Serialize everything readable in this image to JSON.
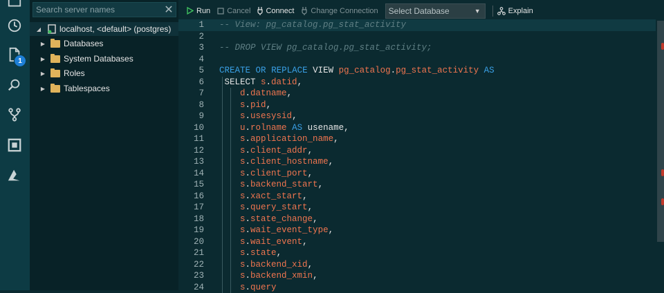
{
  "activity_bar": {
    "icons": [
      "servers-icon",
      "history-icon",
      "file-explorer-icon",
      "search-icon",
      "source-control-icon",
      "extensions-icon",
      "azure-icon"
    ],
    "badge": "1"
  },
  "sidebar": {
    "search_placeholder": "Search server names",
    "server": "localhost, <default> (postgres)",
    "folders": [
      "Databases",
      "System Databases",
      "Roles",
      "Tablespaces"
    ]
  },
  "toolbar": {
    "run": "Run",
    "cancel": "Cancel",
    "connect": "Connect",
    "change_connection": "Change Connection",
    "select_database": "Select Database",
    "explain": "Explain"
  },
  "editor": {
    "lines": [
      {
        "n": "1",
        "tokens": [
          [
            "cm",
            "-- View: pg_catalog.pg_stat_activity"
          ]
        ]
      },
      {
        "n": "2",
        "tokens": []
      },
      {
        "n": "3",
        "tokens": [
          [
            "cm",
            "-- DROP VIEW pg_catalog.pg_stat_activity;"
          ]
        ]
      },
      {
        "n": "4",
        "tokens": []
      },
      {
        "n": "5",
        "tokens": [
          [
            "kw",
            "CREATE"
          ],
          [
            "pl",
            " "
          ],
          [
            "kw",
            "OR"
          ],
          [
            "pl",
            " "
          ],
          [
            "kw",
            "REPLACE"
          ],
          [
            "pl",
            " VIEW "
          ],
          [
            "id",
            "pg_catalog"
          ],
          [
            "pl",
            "."
          ],
          [
            "id",
            "pg_stat_activity"
          ],
          [
            "pl",
            " "
          ],
          [
            "kw",
            "AS"
          ]
        ]
      },
      {
        "n": "6",
        "tokens": [
          [
            "pl",
            " SELECT "
          ],
          [
            "id",
            "s"
          ],
          [
            "pl",
            "."
          ],
          [
            "id",
            "datid"
          ],
          [
            "pl",
            ","
          ]
        ]
      },
      {
        "n": "7",
        "tokens": [
          [
            "pl",
            "    "
          ],
          [
            "id",
            "d"
          ],
          [
            "pl",
            "."
          ],
          [
            "id",
            "datname"
          ],
          [
            "pl",
            ","
          ]
        ]
      },
      {
        "n": "8",
        "tokens": [
          [
            "pl",
            "    "
          ],
          [
            "id",
            "s"
          ],
          [
            "pl",
            "."
          ],
          [
            "id",
            "pid"
          ],
          [
            "pl",
            ","
          ]
        ]
      },
      {
        "n": "9",
        "tokens": [
          [
            "pl",
            "    "
          ],
          [
            "id",
            "s"
          ],
          [
            "pl",
            "."
          ],
          [
            "id",
            "usesysid"
          ],
          [
            "pl",
            ","
          ]
        ]
      },
      {
        "n": "10",
        "tokens": [
          [
            "pl",
            "    "
          ],
          [
            "id",
            "u"
          ],
          [
            "pl",
            "."
          ],
          [
            "id",
            "rolname"
          ],
          [
            "pl",
            " "
          ],
          [
            "kw",
            "AS"
          ],
          [
            "pl",
            " usename,"
          ]
        ]
      },
      {
        "n": "11",
        "tokens": [
          [
            "pl",
            "    "
          ],
          [
            "id",
            "s"
          ],
          [
            "pl",
            "."
          ],
          [
            "id",
            "application_name"
          ],
          [
            "pl",
            ","
          ]
        ]
      },
      {
        "n": "12",
        "tokens": [
          [
            "pl",
            "    "
          ],
          [
            "id",
            "s"
          ],
          [
            "pl",
            "."
          ],
          [
            "id",
            "client_addr"
          ],
          [
            "pl",
            ","
          ]
        ]
      },
      {
        "n": "13",
        "tokens": [
          [
            "pl",
            "    "
          ],
          [
            "id",
            "s"
          ],
          [
            "pl",
            "."
          ],
          [
            "id",
            "client_hostname"
          ],
          [
            "pl",
            ","
          ]
        ]
      },
      {
        "n": "14",
        "tokens": [
          [
            "pl",
            "    "
          ],
          [
            "id",
            "s"
          ],
          [
            "pl",
            "."
          ],
          [
            "id",
            "client_port"
          ],
          [
            "pl",
            ","
          ]
        ]
      },
      {
        "n": "15",
        "tokens": [
          [
            "pl",
            "    "
          ],
          [
            "id",
            "s"
          ],
          [
            "pl",
            "."
          ],
          [
            "id",
            "backend_start"
          ],
          [
            "pl",
            ","
          ]
        ]
      },
      {
        "n": "16",
        "tokens": [
          [
            "pl",
            "    "
          ],
          [
            "id",
            "s"
          ],
          [
            "pl",
            "."
          ],
          [
            "id",
            "xact_start"
          ],
          [
            "pl",
            ","
          ]
        ]
      },
      {
        "n": "17",
        "tokens": [
          [
            "pl",
            "    "
          ],
          [
            "id",
            "s"
          ],
          [
            "pl",
            "."
          ],
          [
            "id",
            "query_start"
          ],
          [
            "pl",
            ","
          ]
        ]
      },
      {
        "n": "18",
        "tokens": [
          [
            "pl",
            "    "
          ],
          [
            "id",
            "s"
          ],
          [
            "pl",
            "."
          ],
          [
            "id",
            "state_change"
          ],
          [
            "pl",
            ","
          ]
        ]
      },
      {
        "n": "19",
        "tokens": [
          [
            "pl",
            "    "
          ],
          [
            "id",
            "s"
          ],
          [
            "pl",
            "."
          ],
          [
            "id",
            "wait_event_type"
          ],
          [
            "pl",
            ","
          ]
        ]
      },
      {
        "n": "20",
        "tokens": [
          [
            "pl",
            "    "
          ],
          [
            "id",
            "s"
          ],
          [
            "pl",
            "."
          ],
          [
            "id",
            "wait_event"
          ],
          [
            "pl",
            ","
          ]
        ]
      },
      {
        "n": "21",
        "tokens": [
          [
            "pl",
            "    "
          ],
          [
            "id",
            "s"
          ],
          [
            "pl",
            "."
          ],
          [
            "id",
            "state"
          ],
          [
            "pl",
            ","
          ]
        ]
      },
      {
        "n": "22",
        "tokens": [
          [
            "pl",
            "    "
          ],
          [
            "id",
            "s"
          ],
          [
            "pl",
            "."
          ],
          [
            "id",
            "backend_xid"
          ],
          [
            "pl",
            ","
          ]
        ]
      },
      {
        "n": "23",
        "tokens": [
          [
            "pl",
            "    "
          ],
          [
            "id",
            "s"
          ],
          [
            "pl",
            "."
          ],
          [
            "id",
            "backend_xmin"
          ],
          [
            "pl",
            ","
          ]
        ]
      },
      {
        "n": "24",
        "tokens": [
          [
            "pl",
            "    "
          ],
          [
            "id",
            "s"
          ],
          [
            "pl",
            "."
          ],
          [
            "id",
            "query"
          ]
        ]
      }
    ]
  }
}
